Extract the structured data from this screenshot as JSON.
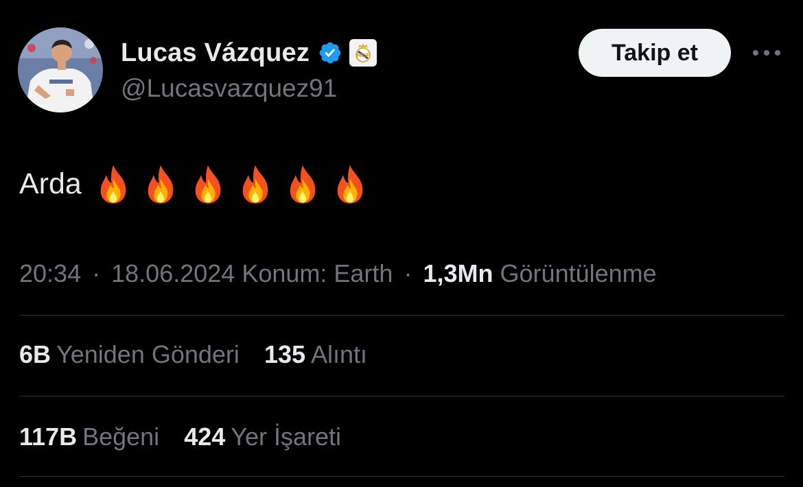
{
  "author": {
    "display_name": "Lucas Vázquez",
    "handle": "@Lucasvazquez91",
    "avatar": "profile-photo",
    "verified_icon": "verified-badge-icon",
    "affiliate_icon": "real-madrid-crest-icon"
  },
  "header": {
    "follow_label": "Takip et",
    "more_icon": "more-options-icon"
  },
  "tweet": {
    "text": "Arda",
    "emoji": [
      "🔥",
      "🔥",
      "🔥",
      "🔥",
      "🔥",
      "🔥"
    ]
  },
  "meta": {
    "time": "20:34",
    "date": "18.06.2024",
    "location": "Konum: Earth",
    "separator": "·",
    "views_count": "1,3Mn",
    "views_label": "Görüntülenme"
  },
  "stats": {
    "reposts_count": "6B",
    "reposts_label": "Yeniden Gönderi",
    "quotes_count": "135",
    "quotes_label": "Alıntı",
    "likes_count": "117B",
    "likes_label": "Beğeni",
    "bookmarks_count": "424",
    "bookmarks_label": "Yer İşareti"
  },
  "colors": {
    "background": "#000000",
    "primary_text": "#e7e9ea",
    "secondary_text": "#71767b",
    "verified_blue": "#1d9bf0",
    "button_bg": "#eff3f4",
    "divider": "#2f3336"
  }
}
